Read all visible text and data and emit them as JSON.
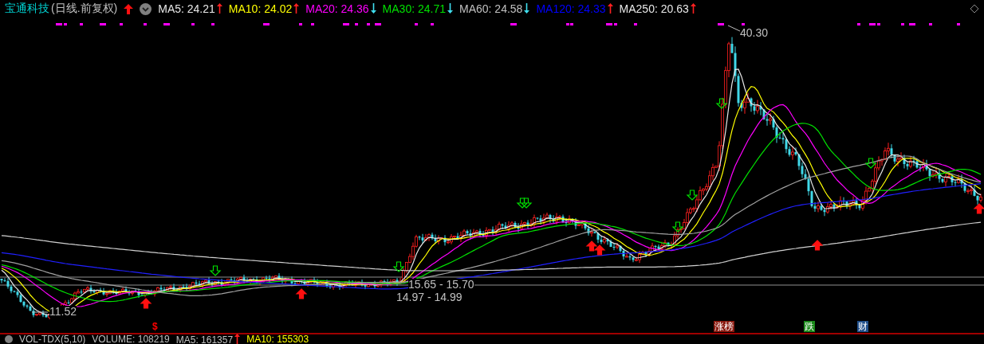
{
  "header": {
    "stock_name": "宝通科技",
    "period": "(日线.前复权)",
    "indicators": [
      {
        "label": "MA5: 24.21",
        "color": "#e8e8e8",
        "rising": true
      },
      {
        "label": "MA10: 24.02",
        "color": "#ffff00",
        "rising": true
      },
      {
        "label": "MA20: 24.36",
        "color": "#ff00ff",
        "rising": false
      },
      {
        "label": "MA30: 24.71",
        "color": "#00e000",
        "rising": false
      },
      {
        "label": "MA60: 24.58",
        "color": "#c0c0c0",
        "rising": false
      },
      {
        "label": "MA120: 24.33",
        "color": "#0000ff",
        "rising": true
      },
      {
        "label": "MA250: 20.63",
        "color": "#e8e8e8",
        "rising": true
      }
    ]
  },
  "price_labels": [
    {
      "text": "40.30"
    },
    {
      "text": "11.52"
    },
    {
      "text": "15.65 - 15.70"
    },
    {
      "text": "14.97 - 14.99"
    }
  ],
  "event_tags": [
    {
      "text": "$",
      "color": "#ff0000",
      "kind": "symbol"
    },
    {
      "text": "涨榜",
      "color": "#8b1a10",
      "kind": "tag"
    },
    {
      "text": "跌",
      "color": "#1a8a1a",
      "kind": "tag"
    },
    {
      "text": "财",
      "color": "#1f4e8a",
      "kind": "tag"
    }
  ],
  "volume_bar": {
    "name": "VOL-TDX(5,10)",
    "items": [
      {
        "label": "VOLUME: 108219",
        "color": "#c0c0c0"
      },
      {
        "label": "MA5: 161357",
        "color": "#c0c0c0",
        "rising": true
      },
      {
        "label": "MA10: 155303",
        "color": "#ffff00"
      }
    ]
  }
}
